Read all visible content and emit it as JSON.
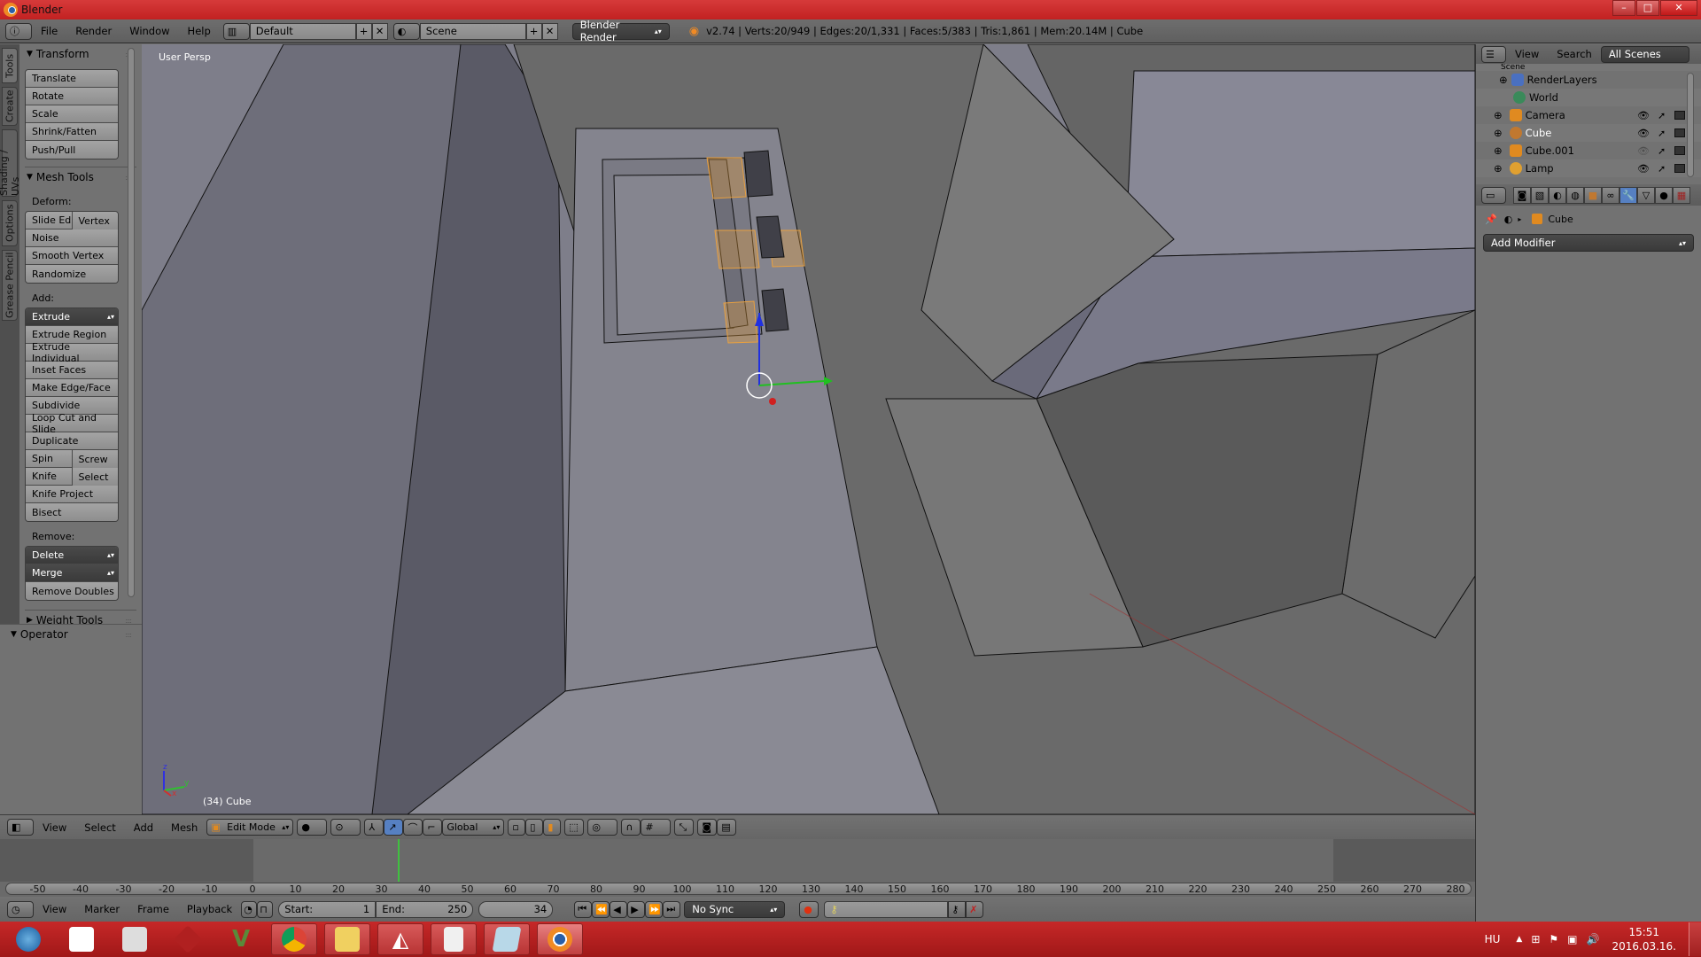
{
  "window": {
    "title": "Blender",
    "controls": {
      "minimize": "–",
      "maximize": "□",
      "close": "✕"
    }
  },
  "infobar": {
    "menus": [
      "File",
      "Render",
      "Window",
      "Help"
    ],
    "layout": "Default",
    "scene": "Scene",
    "engine": "Blender Render",
    "stats": "v2.74 | Verts:20/949 | Edges:20/1,331 | Faces:5/383 | Tris:1,861 | Mem:20.14M | Cube"
  },
  "side_tabs": [
    "Tools",
    "Create",
    "Shading / UVs",
    "Options",
    "Grease Pencil"
  ],
  "tool_panel": {
    "transform": {
      "title": "Transform",
      "buttons": [
        "Translate",
        "Rotate",
        "Scale",
        "Shrink/Fatten",
        "Push/Pull"
      ]
    },
    "mesh_tools": {
      "title": "Mesh Tools",
      "deform_label": "Deform:",
      "deform_row": [
        "Slide Ed",
        "Vertex"
      ],
      "deform_buttons": [
        "Noise",
        "Smooth Vertex",
        "Randomize"
      ],
      "add_label": "Add:",
      "extrude": "Extrude",
      "add_buttons": [
        "Extrude Region",
        "Extrude Individual",
        "Inset Faces",
        "Make Edge/Face",
        "Subdivide",
        "Loop Cut and Slide",
        "Duplicate"
      ],
      "spin_row": [
        "Spin",
        "Screw"
      ],
      "knife_row": [
        "Knife",
        "Select"
      ],
      "add_buttons2": [
        "Knife Project",
        "Bisect"
      ],
      "remove_label": "Remove:",
      "delete": "Delete",
      "merge": "Merge",
      "remove_doubles": "Remove Doubles"
    },
    "weight_tools": {
      "title": "Weight Tools"
    },
    "operator": {
      "title": "Operator"
    }
  },
  "viewport": {
    "view_label": "User Persp",
    "object_label": "(34) Cube",
    "axes": {
      "x": "x",
      "y": "y",
      "z": "z"
    },
    "colors": {
      "selected_face": "#e8a040",
      "x_axis": "#d03030",
      "y_axis": "#30c030",
      "z_axis": "#3030e0"
    }
  },
  "view3d_header": {
    "menus": [
      "View",
      "Select",
      "Add",
      "Mesh"
    ],
    "mode": "Edit Mode",
    "orientation": "Global"
  },
  "timeline": {
    "ticks": [
      -50,
      -40,
      -30,
      -20,
      -10,
      0,
      10,
      20,
      30,
      40,
      50,
      60,
      70,
      80,
      90,
      100,
      110,
      120,
      130,
      140,
      150,
      160,
      170,
      180,
      190,
      200,
      210,
      220,
      230,
      240,
      250,
      260,
      270,
      280
    ],
    "current_frame_value": 34,
    "menus": [
      "View",
      "Marker",
      "Frame",
      "Playback"
    ],
    "start_label": "Start:",
    "start": "1",
    "end_label": "End:",
    "end": "250",
    "current": "34",
    "sync": "No Sync"
  },
  "outliner": {
    "menus": [
      "View",
      "Search"
    ],
    "filter": "All Scenes",
    "scene_partial": "Scene",
    "items": [
      {
        "name": "RenderLayers",
        "icon": "renderlayers-icon",
        "color": "#4a70c0"
      },
      {
        "name": "World",
        "icon": "world-icon",
        "color": "#3a8a5a"
      },
      {
        "name": "Camera",
        "icon": "camera-icon",
        "color": "#e08a20"
      },
      {
        "name": "Cube",
        "icon": "mesh-icon",
        "color": "#e08a20"
      },
      {
        "name": "Cube.001",
        "icon": "mesh-icon",
        "color": "#e08a20"
      },
      {
        "name": "Lamp",
        "icon": "lamp-icon",
        "color": "#e0a030"
      }
    ]
  },
  "properties": {
    "breadcrumb_object": "Cube",
    "add_modifier": "Add Modifier",
    "active_tab_color": "#5680c2"
  },
  "taskbar": {
    "apps": [
      "start",
      "warframe",
      "stormtrooper",
      "game-ace",
      "gta-v",
      "chrome",
      "explorer",
      "unity",
      "notepad-doc",
      "notepad",
      "blender"
    ],
    "language": "HU",
    "time": "15:51",
    "date": "2016.03.16."
  }
}
